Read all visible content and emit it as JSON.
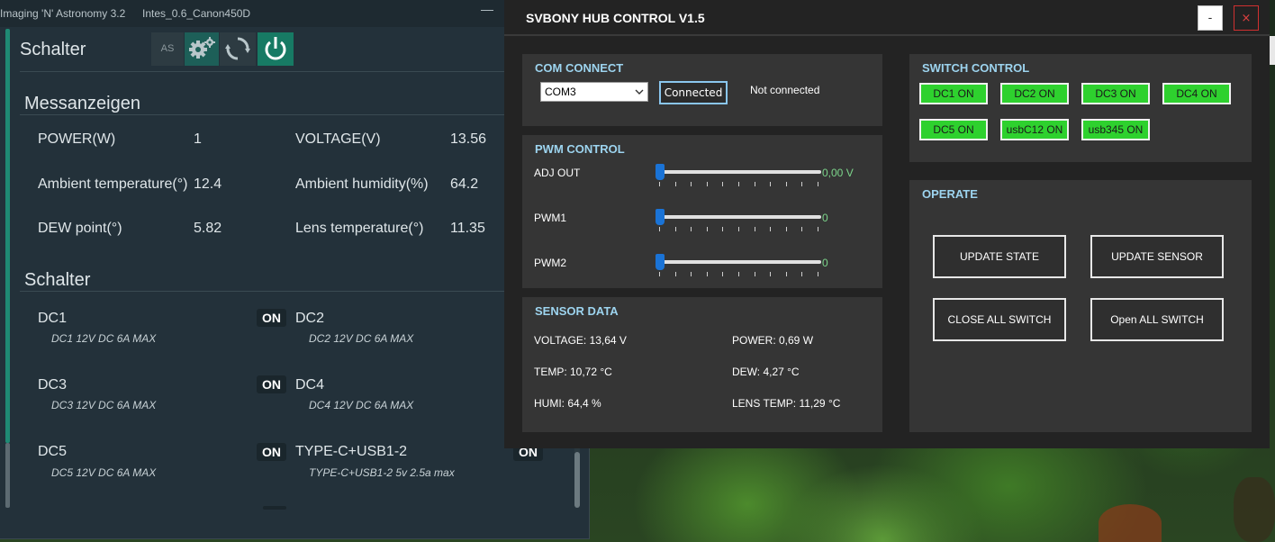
{
  "nina": {
    "title": "Imaging 'N' Astronomy 3.2",
    "profile": "Intes_0.6_Canon450D",
    "minimize": "—",
    "panel_title": "Schalter",
    "as_label": "AS",
    "section_meas": "Messanzeigen",
    "measures": [
      {
        "label": "POWER(W)",
        "value": "1"
      },
      {
        "label": "VOLTAGE(V)",
        "value": "13.56"
      },
      {
        "label": "Ambient temperature(°)",
        "value": "12.4"
      },
      {
        "label": "Ambient humidity(%)",
        "value": "64.2"
      },
      {
        "label": "DEW point(°)",
        "value": "5.82"
      },
      {
        "label": "Lens temperature(°)",
        "value": "11.35"
      }
    ],
    "section_switch": "Schalter",
    "switches": [
      {
        "name": "DC1",
        "desc": "DC1 12V DC 6A MAX",
        "state": "ON"
      },
      {
        "name": "DC2",
        "desc": "DC2 12V DC 6A MAX",
        "state": ""
      },
      {
        "name": "DC3",
        "desc": "DC3 12V DC 6A MAX",
        "state": "ON"
      },
      {
        "name": "DC4",
        "desc": "DC4 12V DC 6A MAX",
        "state": ""
      },
      {
        "name": "DC5",
        "desc": "DC5 12V DC 6A MAX",
        "state": "ON"
      },
      {
        "name": "TYPE-C+USB1-2",
        "desc": "TYPE-C+USB1-2 5v 2.5a max",
        "state": "ON"
      }
    ]
  },
  "svb": {
    "title": "SVBONY HUB CONTROL V1.5",
    "minimize": "-",
    "close": "×",
    "com": {
      "header": "COM CONNECT",
      "port": "COM3",
      "button": "Connected",
      "status": "Not connected"
    },
    "pwm": {
      "header": "PWM CONTROL",
      "channels": [
        {
          "label": "ADJ OUT",
          "value": "0,00 V",
          "level": 0
        },
        {
          "label": "PWM1",
          "value": "0",
          "level": 0
        },
        {
          "label": "PWM2",
          "value": "0",
          "level": 0
        }
      ]
    },
    "sensor": {
      "header": "SENSOR DATA",
      "voltage": "VOLTAGE: 13,64 V",
      "power": "POWER: 0,69 W",
      "temp": "TEMP: 10,72 °C",
      "dew": "DEW: 4,27 °C",
      "humi": "HUMI: 64,4 %",
      "lens": "LENS TEMP: 11,29 °C"
    },
    "switch": {
      "header": "SWITCH CONTROL",
      "buttons": [
        "DC1 ON",
        "DC2 ON",
        "DC3 ON",
        "DC4 ON",
        "DC5 ON",
        "usbC12 ON",
        "usb345 ON"
      ]
    },
    "operate": {
      "header": "OPERATE",
      "update_state": "UPDATE STATE",
      "update_sensor": "UPDATE SENSOR",
      "close_all": "CLOSE ALL SWITCH",
      "open_all": "Open ALL SWITCH"
    }
  },
  "colors": {
    "accent": "#1f8a74",
    "svb_header": "#9dd4ef",
    "switch_green": "#2ed12e",
    "value_green": "#7cd58b",
    "slider_blue": "#1a73d6"
  }
}
